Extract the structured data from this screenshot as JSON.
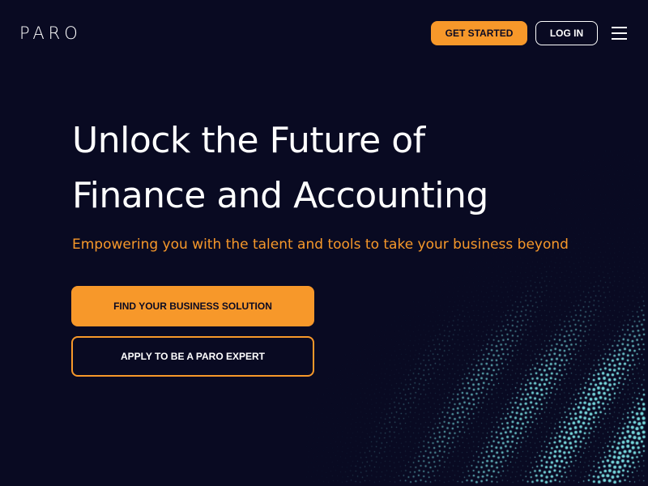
{
  "brand": {
    "logo_text": "PARO"
  },
  "header": {
    "get_started_label": "GET STARTED",
    "login_label": "LOG IN",
    "menu_icon": "hamburger-menu-icon"
  },
  "hero": {
    "headline_line1": "Unlock the Future of",
    "headline_line2": "Finance and Accounting",
    "subhead": "Empowering you with the talent and tools to take your business beyond"
  },
  "cta": {
    "primary_label": "FIND YOUR BUSINESS SOLUTION",
    "secondary_label": "APPLY TO BE A PARO EXPERT"
  },
  "colors": {
    "background": "#090a22",
    "accent": "#f7982a",
    "dots": "#7fe9ec"
  }
}
